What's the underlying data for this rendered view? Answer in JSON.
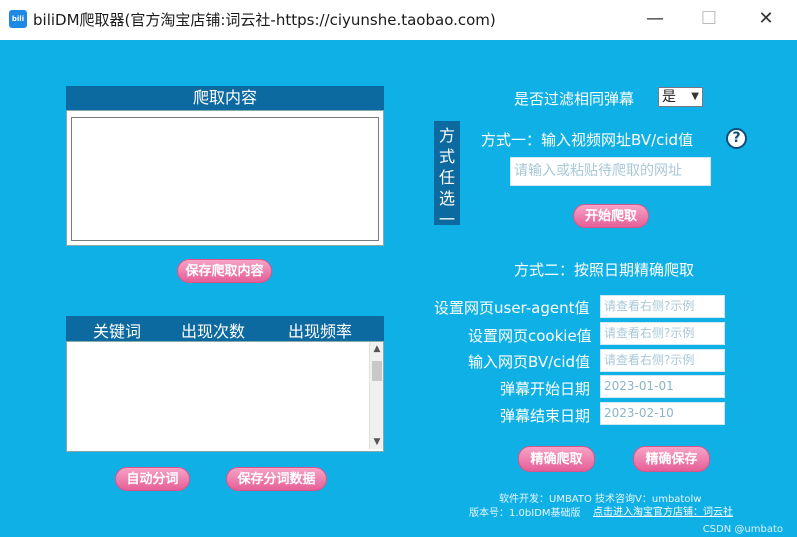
{
  "window": {
    "title": "biliDM爬取器(官方淘宝店铺:词云社-https://ciyunshe.taobao.com)",
    "app_icon_text": "bili",
    "minimize": "—",
    "maximize": "☐",
    "close": "✕"
  },
  "crawl_panel": {
    "header": "爬取内容",
    "content": "",
    "save_label": "保存爬取内容"
  },
  "keyword_panel": {
    "columns": [
      "关键词",
      "出现次数",
      "出现频率"
    ],
    "auto_segment_label": "自动分词",
    "save_segment_label": "保存分词数据"
  },
  "filter": {
    "label": "是否过滤相同弹幕",
    "selected": "是"
  },
  "method_divider": "方式任选一",
  "method1": {
    "label": "方式一：输入视频网址BV/cid值",
    "help": "?",
    "url_placeholder": "请输入或粘贴待爬取的网址",
    "start_label": "开始爬取"
  },
  "method2": {
    "label": "方式二：按照日期精确爬取",
    "ua_label": "设置网页user-agent值",
    "ua_placeholder": "请查看右侧?示例",
    "cookie_label": "设置网页cookie值",
    "cookie_placeholder": "请查看右侧?示例",
    "bv_label": "输入网页BV/cid值",
    "bv_placeholder": "请查看右侧?示例",
    "start_date_label": "弹幕开始日期",
    "start_date": "2023-01-01",
    "end_date_label": "弹幕结束日期",
    "end_date": "2023-02-10",
    "precise_crawl_label": "精确爬取",
    "precise_save_label": "精确保存"
  },
  "footer": {
    "developer": "软件开发：UMBATO     技术咨询V：umbatolw",
    "version": "版本号：1.0bIDM基础版",
    "link": "点击进入淘宝官方店铺：词云社"
  },
  "watermark": "CSDN @umbato"
}
